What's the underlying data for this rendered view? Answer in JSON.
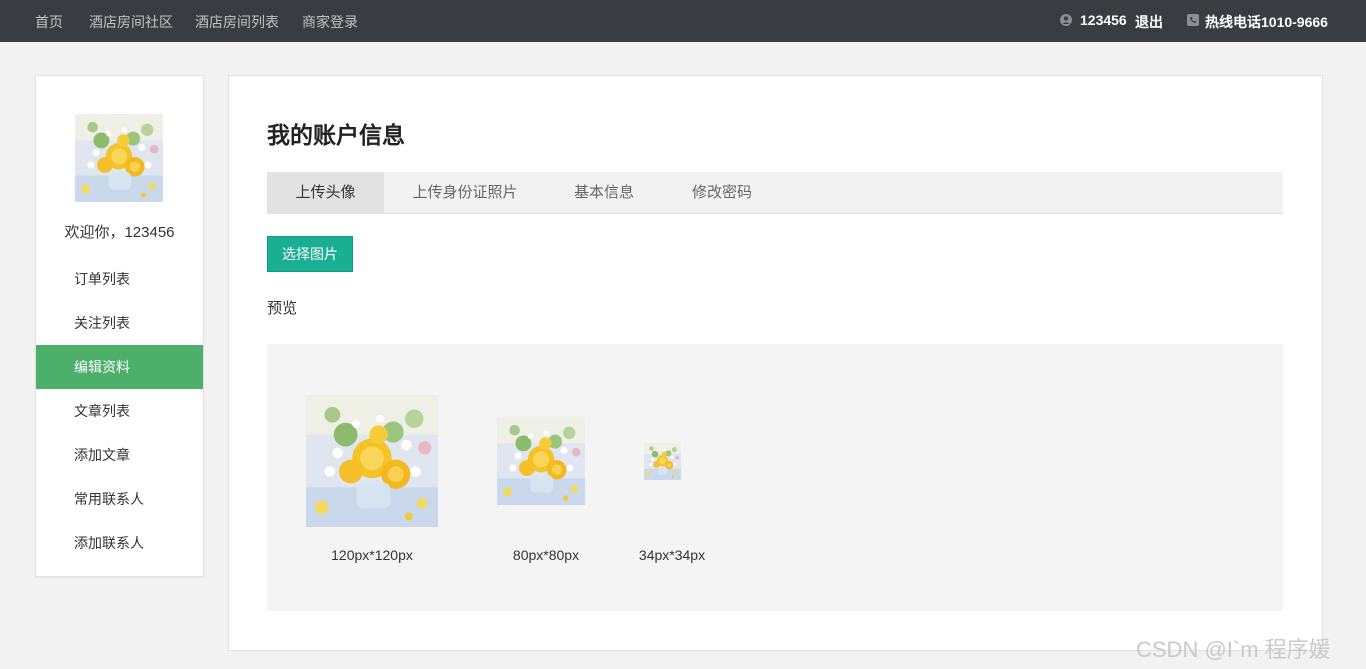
{
  "nav": {
    "home": "首页",
    "community": "酒店房间社区",
    "room_list": "酒店房间列表",
    "merchant_login": "商家登录"
  },
  "user": {
    "username": "123456",
    "logout": "退出",
    "hotline": "热线电话1010-9666"
  },
  "sidebar": {
    "welcome": "欢迎你，123456",
    "items": [
      {
        "label": "订单列表"
      },
      {
        "label": "关注列表"
      },
      {
        "label": "编辑资料"
      },
      {
        "label": "文章列表"
      },
      {
        "label": "添加文章"
      },
      {
        "label": "常用联系人"
      },
      {
        "label": "添加联系人"
      }
    ],
    "active_index": 2,
    "active_color": "#4caf6a"
  },
  "main": {
    "title": "我的账户信息",
    "tabs": [
      {
        "label": "上传头像"
      },
      {
        "label": "上传身份证照片"
      },
      {
        "label": "基本信息"
      },
      {
        "label": "修改密码"
      }
    ],
    "active_tab": 0,
    "pick_button": "选择图片",
    "pick_button_color": "#1aae92",
    "preview_label": "预览",
    "previews": [
      {
        "caption": "120px*120px"
      },
      {
        "caption": "80px*80px"
      },
      {
        "caption": "34px*34px"
      }
    ]
  },
  "watermark": "CSDN @I`m 程序媛"
}
